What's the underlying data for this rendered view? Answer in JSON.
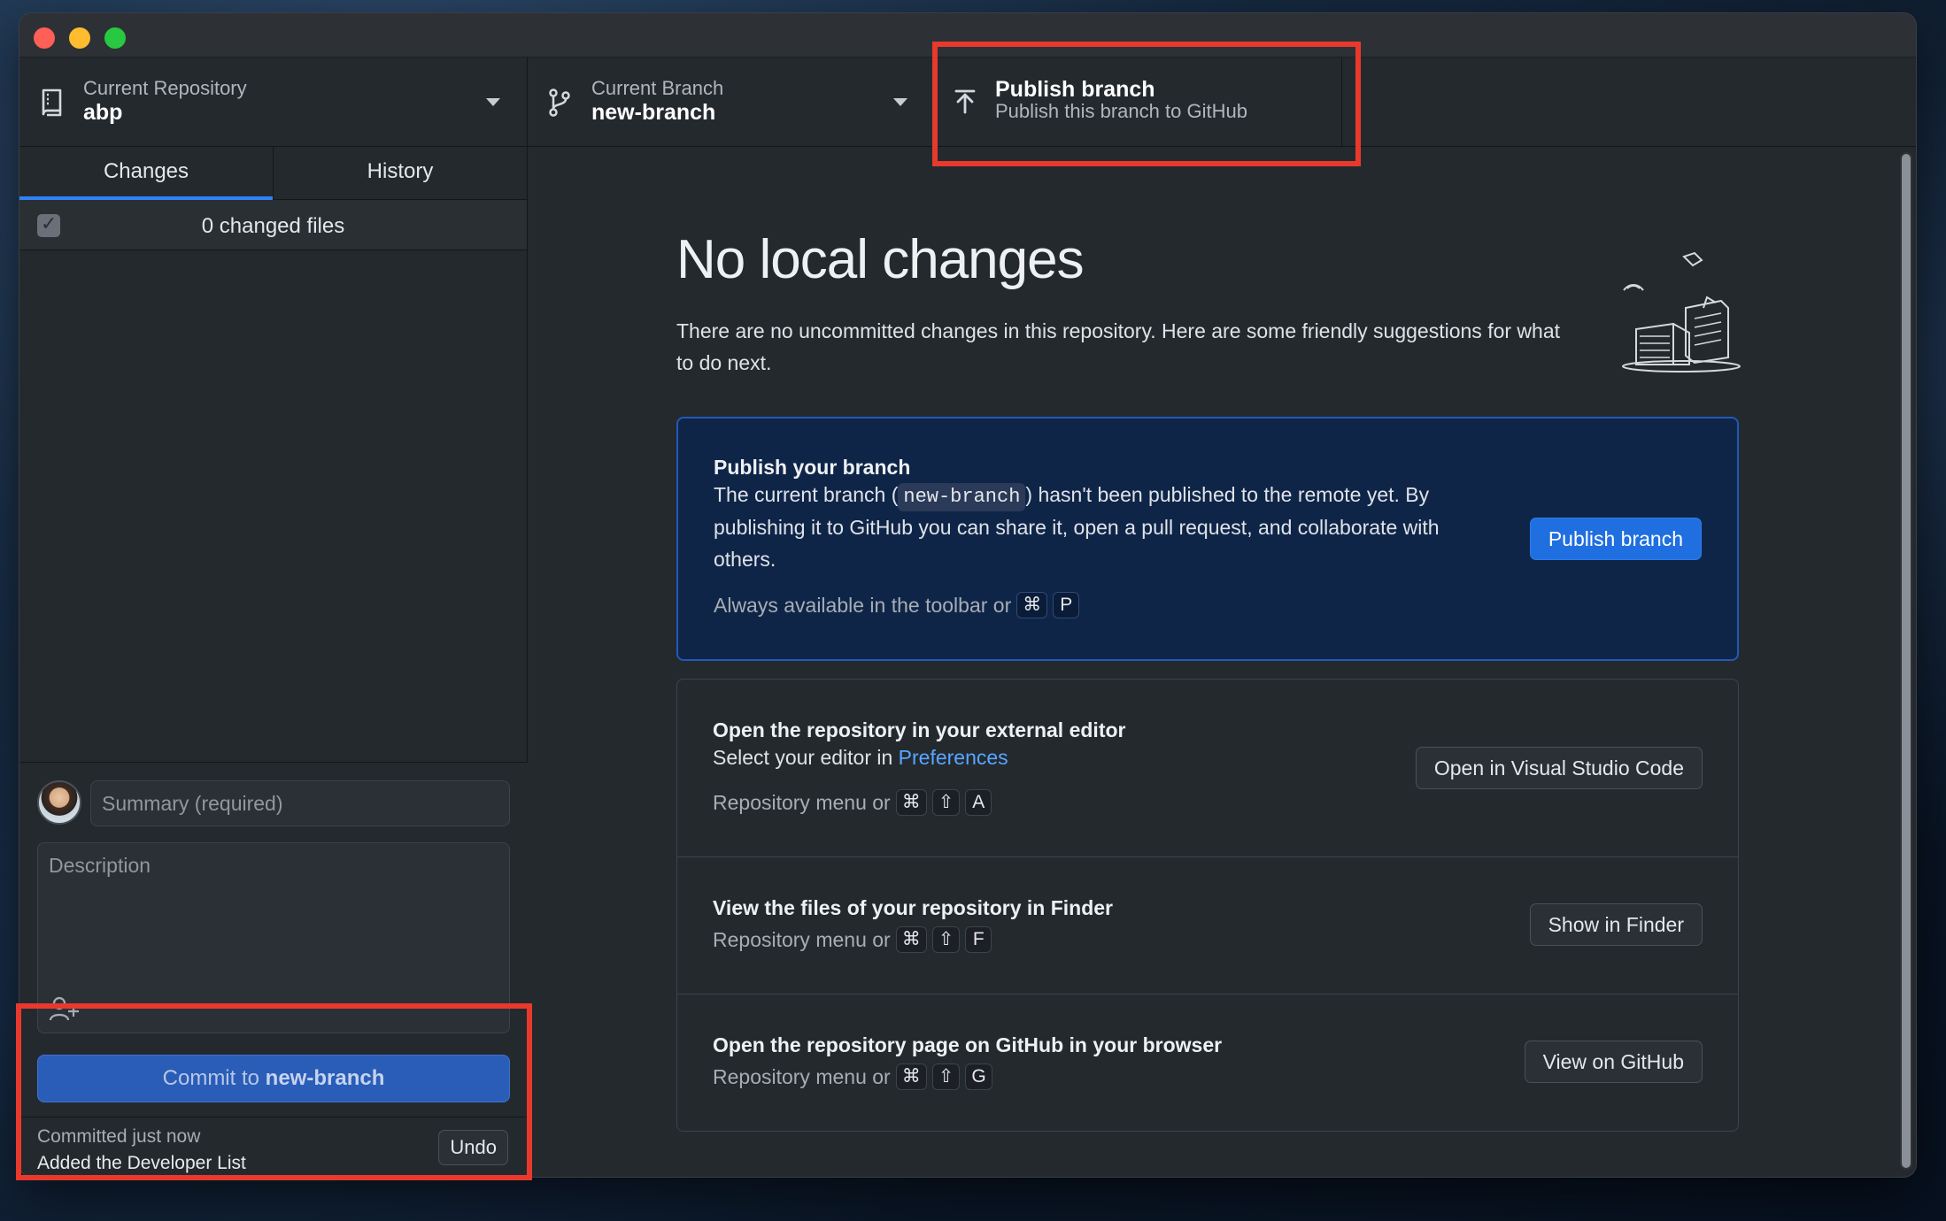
{
  "toolbar": {
    "repository": {
      "sub": "Current Repository",
      "name": "abp"
    },
    "branch": {
      "sub": "Current Branch",
      "name": "new-branch"
    },
    "publish": {
      "title": "Publish branch",
      "sub": "Publish this branch to GitHub"
    }
  },
  "sidebar": {
    "tabs": [
      "Changes",
      "History"
    ],
    "changed_files": "0 changed files",
    "summary_placeholder": "Summary (required)",
    "description_placeholder": "Description",
    "commit_button": {
      "prefix": "Commit to",
      "branch": "new-branch"
    },
    "last_commit": {
      "time": "Committed just now",
      "message": "Added the Developer List",
      "undo": "Undo"
    }
  },
  "main": {
    "title": "No local changes",
    "intro": "There are no uncommitted changes in this repository. Here are some friendly suggestions for what to do next.",
    "publish_card": {
      "title": "Publish your branch",
      "text_before": "The current branch (",
      "branch": "new-branch",
      "text_after": ") hasn't been published to the remote yet. By publishing it to GitHub you can share it, open a pull request, and collaborate with others.",
      "hint": "Always available in the toolbar or",
      "keys": [
        "⌘",
        "P"
      ],
      "button": "Publish branch"
    },
    "editor_card": {
      "title": "Open the repository in your external editor",
      "text": "Select your editor in",
      "link": "Preferences",
      "hint": "Repository menu or",
      "keys": [
        "⌘",
        "⇧",
        "A"
      ],
      "button": "Open in Visual Studio Code"
    },
    "finder_card": {
      "title": "View the files of your repository in Finder",
      "hint": "Repository menu or",
      "keys": [
        "⌘",
        "⇧",
        "F"
      ],
      "button": "Show in Finder"
    },
    "github_card": {
      "title": "Open the repository page on GitHub in your browser",
      "hint": "Repository menu or",
      "keys": [
        "⌘",
        "⇧",
        "G"
      ],
      "button": "View on GitHub"
    }
  },
  "colors": {
    "accent": "#2f81f7",
    "highlight": "#e8392c",
    "primary_button": "#1f6fe0"
  },
  "icons": [
    "repository-icon",
    "branch-icon",
    "upload-icon",
    "chevron-down-icon",
    "add-coauthor-icon",
    "illustration-icon"
  ]
}
